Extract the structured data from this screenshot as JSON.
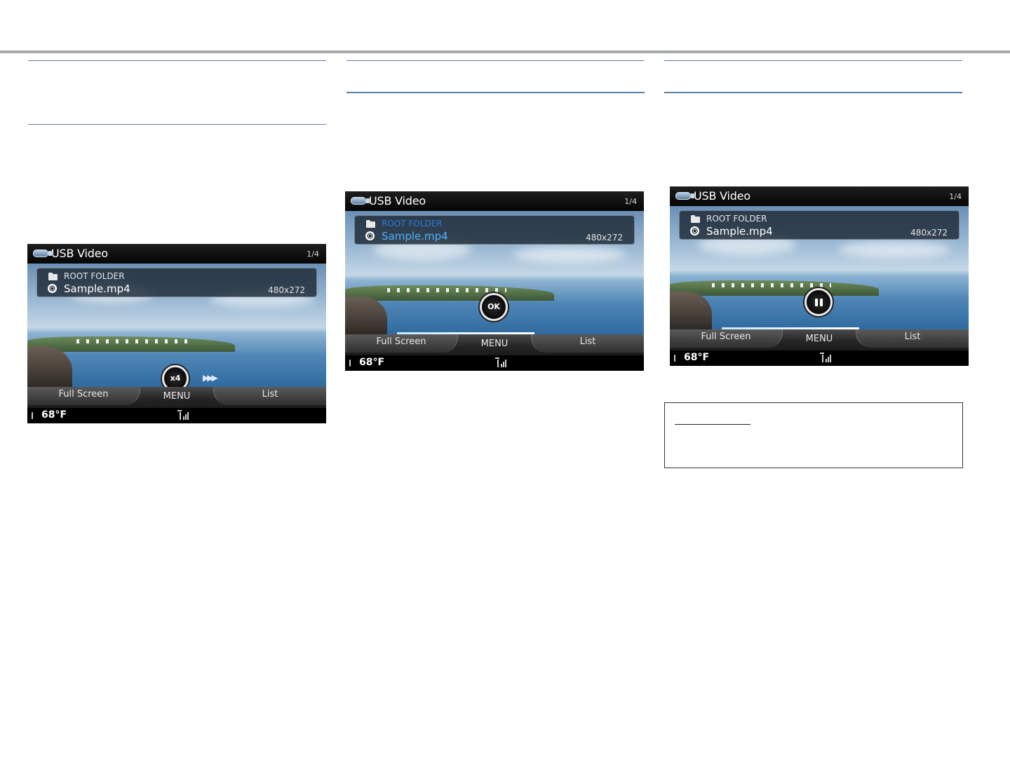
{
  "screens": [
    {
      "id": "fast-forward",
      "title": "USB Video",
      "page": "1/4",
      "folder": "ROOT FOLDER",
      "file": "Sample.mp4",
      "resolution": "480x272",
      "indicator": "x4",
      "indicator_icon": "fast-forward-icon",
      "menu": {
        "left": "Full Screen",
        "middle": "MENU",
        "right": "List"
      },
      "temperature": "68°F"
    },
    {
      "id": "ok",
      "title": "USB Video",
      "page": "1/4",
      "folder": "ROOT FOLDER",
      "file": "Sample.mp4",
      "resolution": "480x272",
      "indicator": "OK",
      "menu": {
        "left": "Full Screen",
        "middle": "MENU",
        "right": "List"
      },
      "temperature": "68°F"
    },
    {
      "id": "pause",
      "title": "USB Video",
      "page": "1/4",
      "folder": "ROOT FOLDER",
      "file": "Sample.mp4",
      "resolution": "480x272",
      "indicator_icon": "pause-icon",
      "menu": {
        "left": "Full Screen",
        "middle": "MENU",
        "right": "List"
      },
      "temperature": "68°F"
    }
  ],
  "colors": {
    "rule": "#5b7fa6",
    "top_rule": "#a9a9a9",
    "highlight_text": "#4fb0ff"
  }
}
